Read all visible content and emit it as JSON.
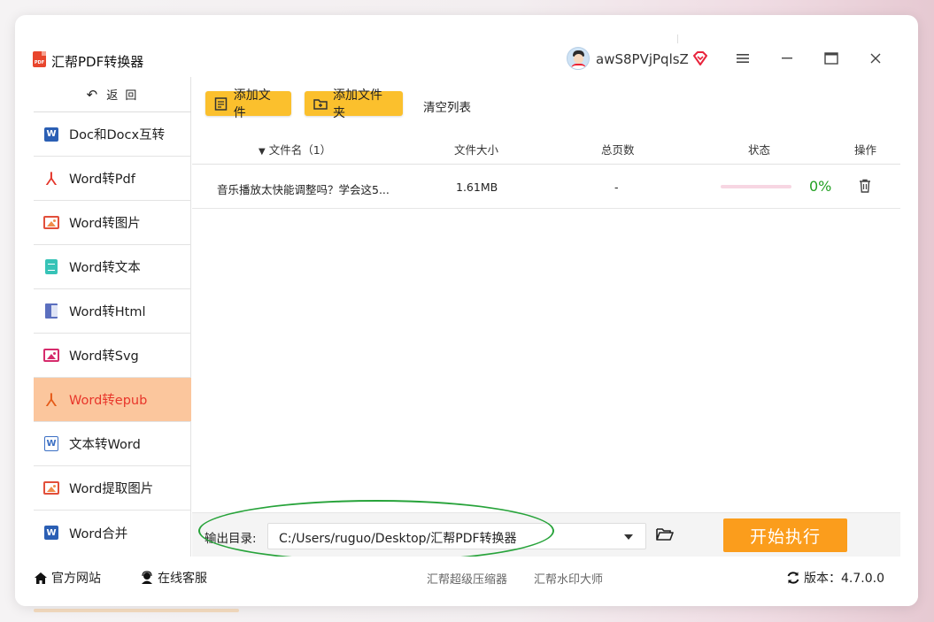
{
  "app": {
    "title": "汇帮PDF转换器",
    "logo_text": "PDF"
  },
  "user": {
    "name": "awS8PVjPqlsZ"
  },
  "sidebar": {
    "back_label": "返 回",
    "items": [
      {
        "label": "Doc和Docx互转",
        "icon": "word-icon"
      },
      {
        "label": "Word转Pdf",
        "icon": "pdf-icon"
      },
      {
        "label": "Word转图片",
        "icon": "image-icon"
      },
      {
        "label": "Word转文本",
        "icon": "text-file-icon"
      },
      {
        "label": "Word转Html",
        "icon": "html-file-icon"
      },
      {
        "label": "Word转Svg",
        "icon": "image-icon"
      },
      {
        "label": "Word转epub",
        "icon": "pdf-icon",
        "active": true
      },
      {
        "label": "文本转Word",
        "icon": "word-outline-icon"
      },
      {
        "label": "Word提取图片",
        "icon": "image-icon"
      },
      {
        "label": "Word合并",
        "icon": "word-icon"
      }
    ]
  },
  "toolbar": {
    "add_file": "添加文件",
    "add_folder": "添加文件夹",
    "clear_list": "清空列表"
  },
  "table": {
    "headers": {
      "name": "文件名（1）",
      "size": "文件大小",
      "pages": "总页数",
      "status": "状态",
      "ops": "操作"
    },
    "rows": [
      {
        "name": "音乐播放太快能调整吗？学会这5...",
        "size": "1.61MB",
        "pages": "-",
        "progress_pct": "0%",
        "progress": 0
      }
    ]
  },
  "output": {
    "label": "输出目录:",
    "path": "C:/Users/ruguo/Desktop/汇帮PDF转换器",
    "start_label": "开始执行"
  },
  "footer": {
    "website": "官方网站",
    "service": "在线客服",
    "compress": "汇帮超级压缩器",
    "watermark": "汇帮水印大师",
    "version": "版本：4.7.0.0"
  },
  "colors": {
    "accent_yellow": "#fbc02d",
    "start_orange": "#fb9d1c",
    "active_bg": "#fbc69d",
    "active_text": "#e8352a",
    "progress_text": "#22a022",
    "annotation_green": "#27a33a"
  }
}
